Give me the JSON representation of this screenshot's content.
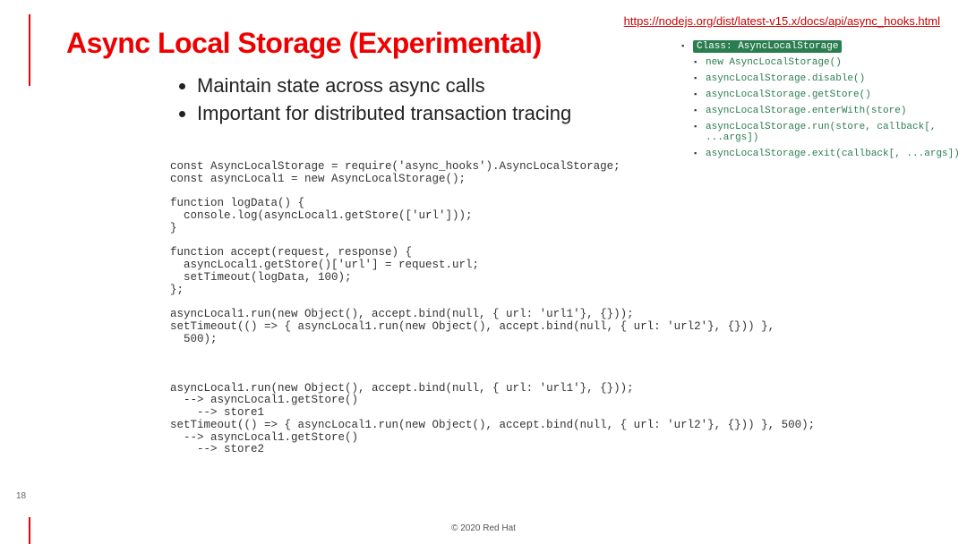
{
  "title": "Async Local Storage (Experimental)",
  "bullets": [
    "Maintain state across async calls",
    "Important for distributed transaction tracing"
  ],
  "url": "https://nodejs.org/dist/latest-v15.x/docs/api/async_hooks.html",
  "toc": {
    "highlight": "Class: AsyncLocalStorage",
    "items": [
      "new AsyncLocalStorage()",
      "asyncLocalStorage.disable()",
      "asyncLocalStorage.getStore()",
      "asyncLocalStorage.enterWith(store)",
      "asyncLocalStorage.run(store, callback[, ...args])",
      "asyncLocalStorage.exit(callback[, ...args])"
    ]
  },
  "code": "const AsyncLocalStorage = require('async_hooks').AsyncLocalStorage;\nconst asyncLocal1 = new AsyncLocalStorage();\n\nfunction logData() {\n  console.log(asyncLocal1.getStore(['url']));\n}\n\nfunction accept(request, response) {\n  asyncLocal1.getStore()['url'] = request.url;\n  setTimeout(logData, 100);\n};\n\nasyncLocal1.run(new Object(), accept.bind(null, { url: 'url1'}, {}));\nsetTimeout(() => { asyncLocal1.run(new Object(), accept.bind(null, { url: 'url2'}, {})) },\n  500);\n\n\n\nasyncLocal1.run(new Object(), accept.bind(null, { url: 'url1'}, {}));\n  --> asyncLocal1.getStore()\n    --> store1\nsetTimeout(() => { asyncLocal1.run(new Object(), accept.bind(null, { url: 'url2'}, {})) }, 500);\n  --> asyncLocal1.getStore()\n    --> store2",
  "pagenum": "18",
  "footer": "© 2020 Red Hat"
}
